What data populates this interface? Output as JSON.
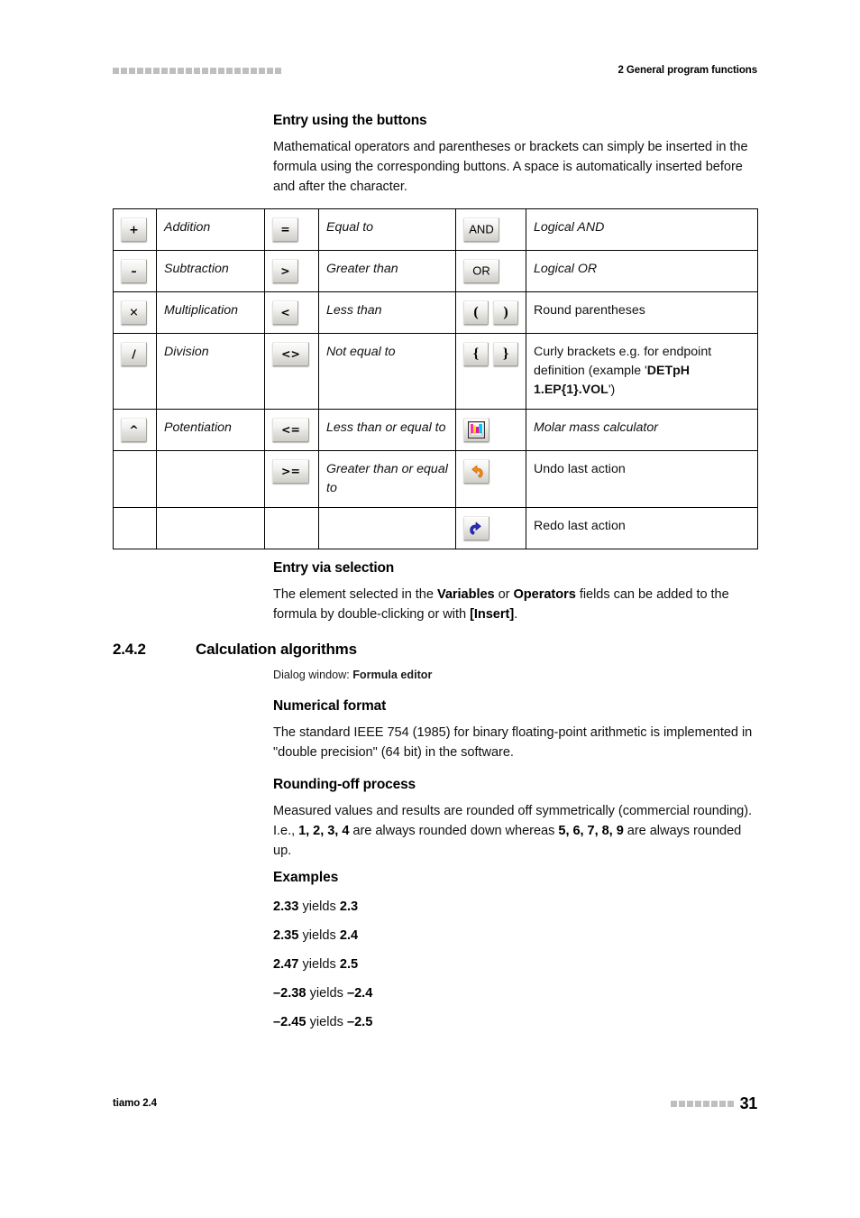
{
  "header": {
    "marker_squares": 21,
    "chapter_title": "2 General program functions"
  },
  "intro": {
    "heading": "Entry using the buttons",
    "paragraph": "Mathematical operators and parentheses or brackets can simply be inserted in the formula using the corresponding buttons. A space is automatically inserted before and after the character."
  },
  "operator_table": {
    "rows": [
      {
        "c1_button": "+",
        "c1_icon": "plus-button",
        "c1_label": "Addition",
        "c1_italic": true,
        "c2_button": "=",
        "c2_icon": "equals-button",
        "c2_label": "Equal to",
        "c2_italic": true,
        "c3_button": "AND",
        "c3_icon": "logical-and-button",
        "c3_label": "Logical AND",
        "c3_italic": true
      },
      {
        "c1_button": "–",
        "c1_icon": "minus-button",
        "c1_label": "Subtraction",
        "c1_italic": true,
        "c2_button": ">",
        "c2_icon": "greater-than-button",
        "c2_label": "Greater than",
        "c2_italic": true,
        "c3_button": "OR",
        "c3_icon": "logical-or-button",
        "c3_label": "Logical OR",
        "c3_italic": true
      },
      {
        "c1_button": "✕",
        "c1_icon": "multiply-button",
        "c1_label": "Multiplication",
        "c1_italic": true,
        "c2_button": "<",
        "c2_icon": "less-than-button",
        "c2_label": "Less than",
        "c2_italic": true,
        "c3_button": "( )",
        "c3_icon": "round-parentheses-buttons",
        "c3_label": "Round parentheses",
        "c3_italic": false
      },
      {
        "c1_button": "/",
        "c1_icon": "divide-button",
        "c1_label": "Division",
        "c1_italic": true,
        "c2_button": "<>",
        "c2_icon": "not-equal-button",
        "c2_label": "Not equal to",
        "c2_italic": true,
        "c3_button": "{ }",
        "c3_icon": "curly-brackets-buttons",
        "c3_label_pre": "Curly brackets e.g. for endpoint definition (example ",
        "c3_label_bold": "DETpH 1.EP{1}.VOL",
        "c3_label_post": ")",
        "c3_italic": false
      },
      {
        "c1_button": "^",
        "c1_icon": "power-button",
        "c1_label": "Potentiation",
        "c1_italic": true,
        "c2_button": "<=",
        "c2_icon": "less-or-equal-button",
        "c2_label": "Less than or equal to",
        "c2_italic": true,
        "c3_button": "",
        "c3_icon": "molar-mass-calculator-button",
        "c3_label": "Molar mass calculator",
        "c3_italic": true
      },
      {
        "c1_button": "",
        "c1_icon": "",
        "c1_label": "",
        "c1_italic": false,
        "c2_button": ">=",
        "c2_icon": "greater-or-equal-button",
        "c2_label": "Greater than or equal to",
        "c2_italic": true,
        "c3_button": "",
        "c3_icon": "undo-button",
        "c3_label": "Undo last action",
        "c3_italic": false
      },
      {
        "c1_button": "",
        "c1_icon": "",
        "c1_label": "",
        "c1_italic": false,
        "c2_button": "",
        "c2_icon": "",
        "c2_label": "",
        "c2_italic": false,
        "c3_button": "",
        "c3_icon": "redo-button",
        "c3_label": "Redo last action",
        "c3_italic": false
      }
    ]
  },
  "entry_via_selection": {
    "heading": "Entry via selection",
    "text_1": "The element selected in the ",
    "bold_1": "Variables",
    "text_2": " or ",
    "bold_2": "Operators",
    "text_3": " fields can be added to the formula by double-clicking or with ",
    "bold_3": "[Insert]",
    "text_4": "."
  },
  "section": {
    "number": "2.4.2",
    "title": "Calculation algorithms",
    "dialog_prefix": "Dialog window: ",
    "dialog_name": "Formula editor"
  },
  "numerical_format": {
    "heading": "Numerical format",
    "paragraph": "The standard IEEE 754 (1985) for binary floating-point arithmetic is implemented in \"double precision\" (64 bit) in the software."
  },
  "rounding": {
    "heading": "Rounding-off process",
    "text_1": "Measured values and results are rounded off symmetrically (commercial rounding). I.e., ",
    "bold_1": "1, 2, 3, 4",
    "text_2": " are always rounded down whereas ",
    "bold_2": "5, 6, 7, 8, 9",
    "text_3": " are always rounded up."
  },
  "examples": {
    "heading": "Examples",
    "yields_word": "yields",
    "items": [
      {
        "input": "2.33",
        "output": "2.3"
      },
      {
        "input": "2.35",
        "output": "2.4"
      },
      {
        "input": "2.47",
        "output": "2.5"
      },
      {
        "input": "–2.38",
        "output": "–2.4"
      },
      {
        "input": "–2.45",
        "output": "–2.5"
      }
    ]
  },
  "footer": {
    "product": "tiamo 2.4",
    "marker_squares": 8,
    "page_number": "31"
  },
  "colors": {
    "marker_gray": "#bfbfbf",
    "button_face": "#e8e7e3",
    "button_border": "#a6a49d",
    "undo_orange": "#f08a1e",
    "redo_blue": "#2b2bbf",
    "icon_magenta": "#ff00a0",
    "icon_yellow": "#ffe400",
    "icon_cyan": "#00c8ff"
  }
}
